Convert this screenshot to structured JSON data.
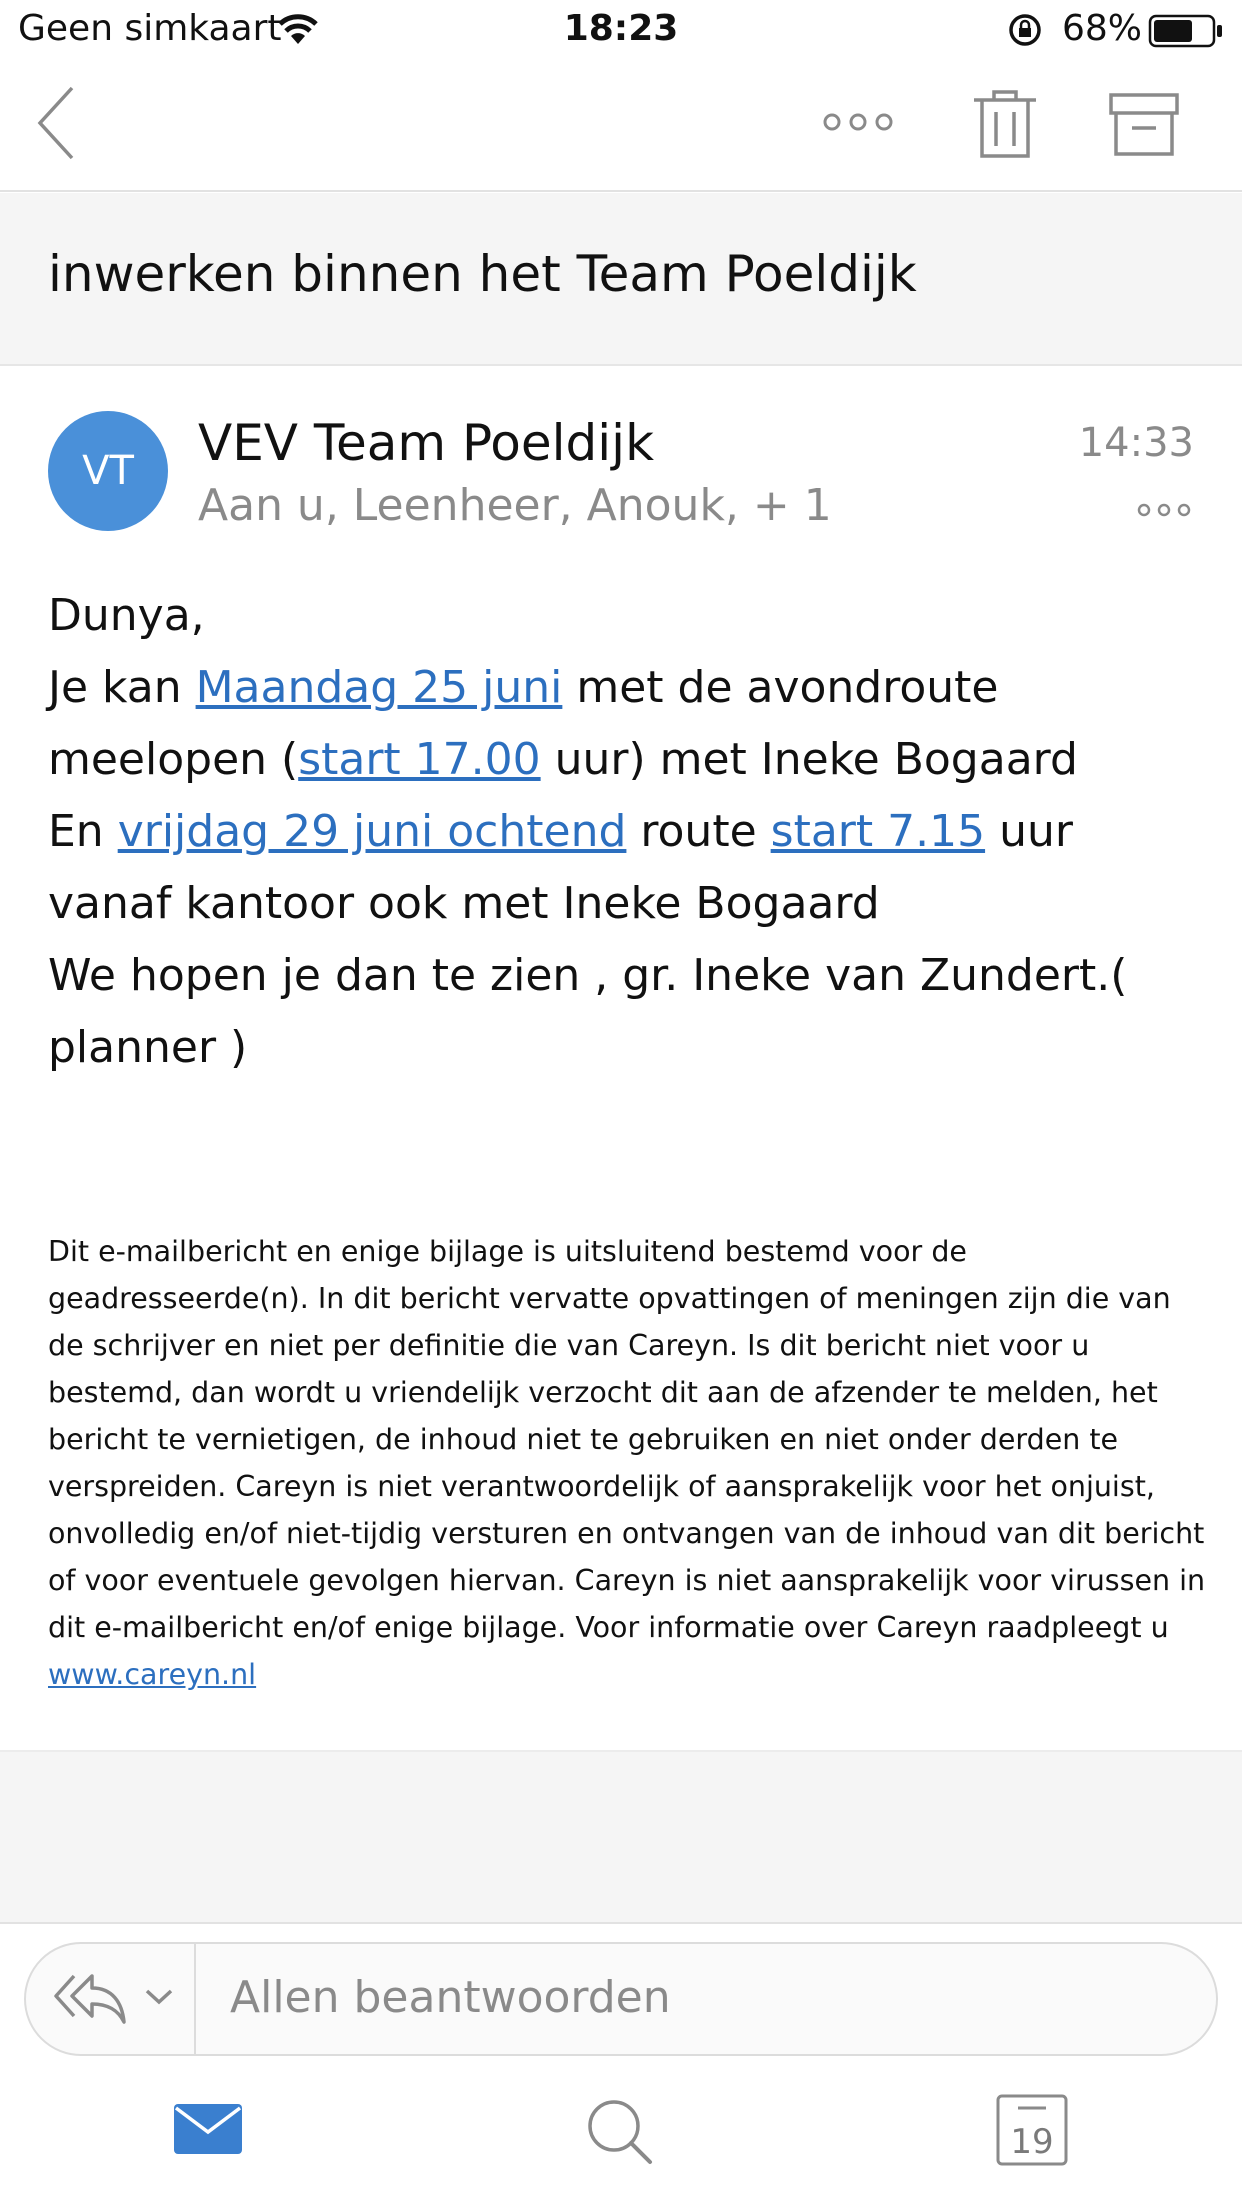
{
  "status_bar": {
    "carrier": "Geen simkaart",
    "time": "18:23",
    "battery_percent": "68%",
    "battery_level": 0.68,
    "icons": [
      "wifi-icon",
      "orientation-lock-icon",
      "battery-icon"
    ]
  },
  "nav": {
    "icons": [
      "back-chevron-icon",
      "more-horizontal-icon",
      "trash-icon",
      "archive-icon"
    ]
  },
  "message": {
    "subject": "inwerken binnen het Team Poeldijk",
    "avatar_initials": "VT",
    "avatar_color": "#4a90d9",
    "sender": "VEV Team Poeldijk",
    "recipients": "Aan u, Leenheer, Anouk, + 1",
    "time": "14:33",
    "body": {
      "greeting": "Dunya,",
      "line2_pre": "Je kan ",
      "line2_link": "Maandag 25 juni",
      "line2_post": " met de avondroute meelopen (",
      "line3_link": "start 17.00",
      "line3_post": " uur) met Ineke Bogaard",
      "line4_pre": "En ",
      "line4_link1": "vrijdag 29 juni ochtend",
      "line4_mid": " route ",
      "line4_link2": "start 7.15",
      "line4_post": " uur vanaf kantoor ook met Ineke Bogaard",
      "line5": "We hopen je dan te zien , gr. Ineke van Zundert.( planner )"
    },
    "disclaimer": {
      "text": "Dit e-mailbericht en enige bijlage is uitsluitend bestemd voor de geadresseerde(n). In dit bericht vervatte opvattingen of meningen zijn die van de schrijver en niet per definitie die van Careyn. Is dit bericht niet voor u bestemd, dan wordt u vriendelijk verzocht dit aan de afzender te melden, het bericht te vernietigen, de inhoud niet te gebruiken en niet onder derden te verspreiden. Careyn is niet verantwoordelijk of aansprakelijk voor het onjuist, onvolledig en/of niet-tijdig versturen en ontvangen van de inhoud van dit bericht of voor eventuele gevolgen hiervan. Careyn is niet aansprakelijk voor virussen in dit e-mailbericht en/of enige bijlage. Voor informatie over Careyn raadpleegt u ",
      "link": "www.careyn.nl"
    },
    "link_color": "#2c6fbf"
  },
  "reply": {
    "label": "Allen beantwoorden",
    "icons": [
      "reply-all-icon",
      "chevron-down-icon"
    ]
  },
  "tabbar": {
    "calendar_day": "19",
    "icons": [
      "mail-icon",
      "search-icon",
      "calendar-icon"
    ],
    "active_color": "#3a7fcf"
  }
}
